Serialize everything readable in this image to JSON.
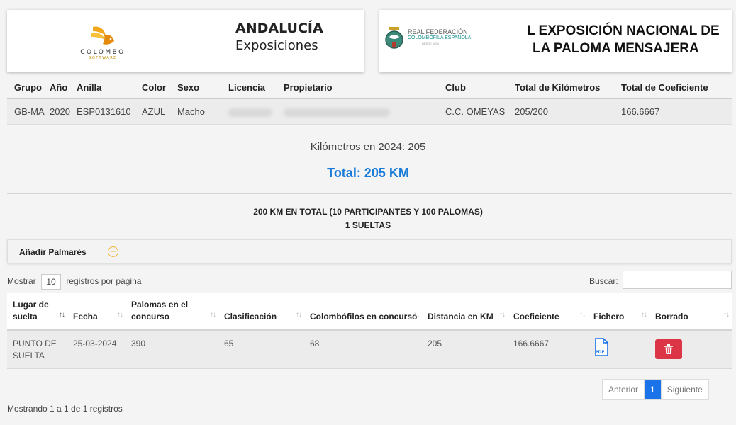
{
  "header": {
    "colombo_word": "COLOMBO",
    "colombo_sub": "SOFTWARE",
    "andalucia_title": "ANDALUCÍA",
    "andalucia_sub": "Exposiciones",
    "rfce_line1": "REAL FEDERACIÓN",
    "rfce_line2": "COLOMBÓFILA ESPAÑOLA",
    "rfce_line3": "DESDE 1894",
    "expo_line1": "L EXPOSICIÓN NACIONAL DE",
    "expo_line2": "LA PALOMA MENSAJERA"
  },
  "pigeon_table": {
    "columns": [
      "Grupo",
      "Año",
      "Anilla",
      "Color",
      "Sexo",
      "Licencia",
      "Propietario",
      "Club",
      "Total de Kilómetros",
      "Total de Coeficiente"
    ],
    "row": {
      "grupo": "GB-MA",
      "anio": "2020",
      "anilla": "ESP0131610",
      "color": "AZUL",
      "sexo": "Macho",
      "club": "C.C. OMEYAS",
      "total_km": "205/200",
      "total_coef": "166.6667"
    }
  },
  "km": {
    "year_line": "Kilómetros en 2024: 205",
    "total": "Total: 205 KM"
  },
  "summary": {
    "line1": "200 KM EN TOTAL (10 PARTICIPANTES Y 100 PALOMAS)",
    "line2": "1 SUELTAS"
  },
  "palmares": {
    "label": "Añadir Palmarés",
    "plus": "+"
  },
  "controls": {
    "mostrar": "Mostrar",
    "page_length": "10",
    "registros": "registros por página",
    "buscar": "Buscar:"
  },
  "results_table": {
    "columns": [
      "Lugar de suelta",
      "Fecha",
      "Palomas en el concurso",
      "Clasificación",
      "Colombófilos en concurso",
      "Distancia en KM",
      "Coeficiente",
      "Fichero",
      "Borrado"
    ],
    "rows": [
      {
        "lugar": "PUNTO DE SUELTA",
        "fecha": "25-03-2024",
        "palomas": "390",
        "clasificacion": "65",
        "colombofilos": "68",
        "distancia": "205",
        "coeficiente": "166.6667"
      }
    ]
  },
  "footer": {
    "mostrando": "Mostrando 1 a 1 de 1 registros",
    "anterior": "Anterior",
    "page": "1",
    "siguiente": "Siguiente"
  },
  "colors": {
    "accent_blue": "#1a7bd8",
    "delete_red": "#dc3545",
    "plus_orange": "#f0b63c"
  }
}
